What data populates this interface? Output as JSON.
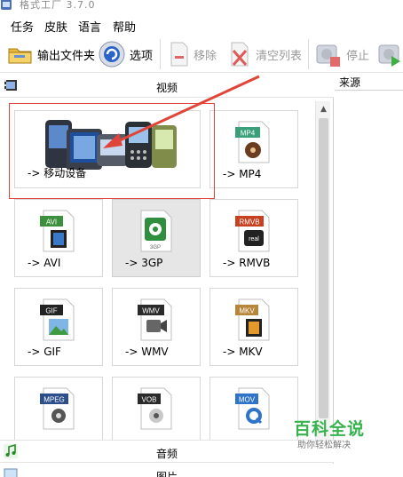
{
  "window": {
    "title": "格式工厂 3.7.0"
  },
  "menu": {
    "items": [
      "任务",
      "皮肤",
      "语言",
      "帮助"
    ]
  },
  "toolbar": {
    "output_folder": "输出文件夹",
    "options": "选项",
    "remove": "移除",
    "clear_list": "清空列表",
    "stop": "停止"
  },
  "categories": {
    "video": "视频",
    "audio": "音频",
    "picture": "图片"
  },
  "task_list": {
    "source_header": "来源"
  },
  "formats": [
    {
      "label": "-> 移动设备",
      "badge": ""
    },
    {
      "label": "-> MP4",
      "badge": "MP4"
    },
    {
      "label": "-> AVI",
      "badge": "AVI"
    },
    {
      "label": "-> 3GP",
      "badge": "3GP"
    },
    {
      "label": "-> RMVB",
      "badge": "RMVB"
    },
    {
      "label": "-> GIF",
      "badge": "GIF"
    },
    {
      "label": "-> WMV",
      "badge": "WMV"
    },
    {
      "label": "-> MKV",
      "badge": "MKV"
    },
    {
      "label": "",
      "badge": "MPEG"
    },
    {
      "label": "",
      "badge": "VOB"
    },
    {
      "label": "",
      "badge": "MOV"
    }
  ],
  "watermark": {
    "main": "百科全说",
    "sub": "助你轻松解决"
  },
  "colors": {
    "highlight": "#e0453a",
    "watermark_green": "#37b24d",
    "selected_tile": "#e6e6e6"
  }
}
